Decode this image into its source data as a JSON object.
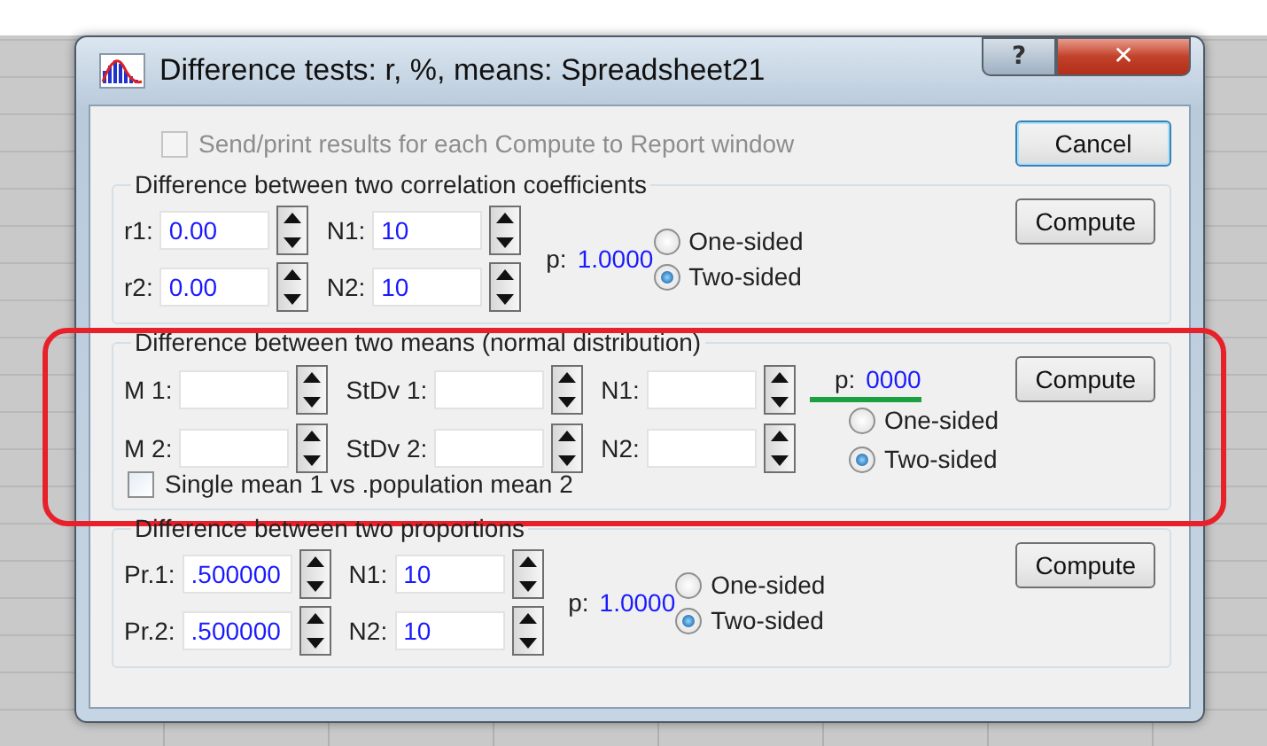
{
  "window": {
    "title": "Difference tests: r, %, means: Spreadsheet21",
    "help_button": "?",
    "close_button": "✕"
  },
  "report_option": {
    "label": "Send/print results for each Compute to Report window",
    "checked": false,
    "disabled": true
  },
  "cancel_button": "Cancel",
  "sections": [
    {
      "kind": "paired",
      "title": "Difference between two correlation coefficients",
      "rows": [
        [
          {
            "label": "r1:",
            "value": "0.00"
          },
          {
            "label": "N1:",
            "value": "10"
          }
        ],
        [
          {
            "label": "r2:",
            "value": "0.00"
          },
          {
            "label": "N2:",
            "value": "10"
          }
        ]
      ],
      "p_label": "p:",
      "p_value": "1.0000",
      "options": [
        {
          "label": "One-sided",
          "selected": false
        },
        {
          "label": "Two-sided",
          "selected": true
        }
      ],
      "compute": "Compute"
    },
    {
      "kind": "means",
      "title": "Difference between two means (normal distribution)",
      "highlighted": true,
      "rows": [
        [
          {
            "label": "M 1:"
          },
          {
            "label": "StDv 1:"
          },
          {
            "label": "N1:"
          }
        ],
        [
          {
            "label": "M 2:"
          },
          {
            "label": "StDv 2:"
          },
          {
            "label": "N2:"
          }
        ]
      ],
      "single_mean": {
        "label": "Single mean 1 vs .population mean 2",
        "checked": false
      },
      "p_label": "p:",
      "p_value": "0000",
      "p_underlined": true,
      "options": [
        {
          "label": "One-sided",
          "selected": false
        },
        {
          "label": "Two-sided",
          "selected": true
        }
      ],
      "compute": "Compute"
    },
    {
      "kind": "paired",
      "title": "Difference between two proportions",
      "rows": [
        [
          {
            "label": "Pr.1:",
            "value": ".500000"
          },
          {
            "label": "N1:",
            "value": "10"
          }
        ],
        [
          {
            "label": "Pr.2:",
            "value": ".500000"
          },
          {
            "label": "N2:",
            "value": "10"
          }
        ]
      ],
      "p_label": "p:",
      "p_value": "1.0000",
      "options": [
        {
          "label": "One-sided",
          "selected": false
        },
        {
          "label": "Two-sided",
          "selected": true
        }
      ],
      "compute": "Compute"
    }
  ]
}
